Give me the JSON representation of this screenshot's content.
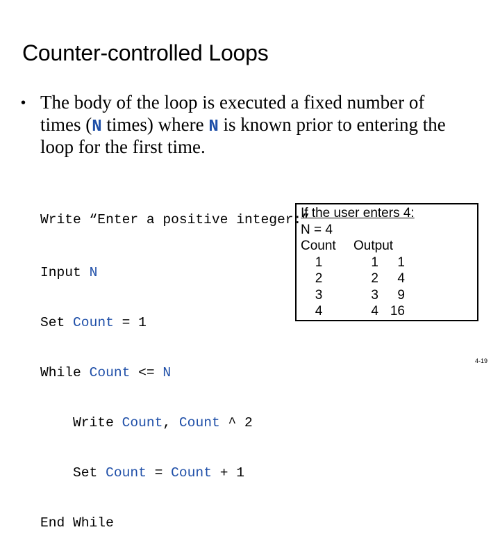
{
  "slide": {
    "title": "Counter-controlled Loops",
    "bullet": {
      "marker": "•",
      "line1": "The body of the loop is executed a fixed number of",
      "line2_prefix": "times (",
      "line2_kw1": "N",
      "line2_middle": " times) where ",
      "line2_kw2": "N",
      "line2_suffix": " is known prior to entering the",
      "line3": "loop for the first time."
    },
    "pseudocode": {
      "line1": "Write “Enter a positive integer:”",
      "line2_text": "Input ",
      "line2_var": "N",
      "line3_text": "Set ",
      "line3_var": "Count",
      "line3_rest": " = 1",
      "line4_text": "While ",
      "line4_var1": "Count",
      "line4_mid": " <= ",
      "line4_var2": "N",
      "line5_indent": "    Write ",
      "line5_var1": "Count",
      "line5_mid": ", ",
      "line5_var2": "Count",
      "line5_rest": " ^ 2",
      "line6_indent": "    Set ",
      "line6_var1": "Count",
      "line6_mid": " = ",
      "line6_var2": "Count",
      "line6_rest": " + 1",
      "line7": "End While"
    },
    "trace": {
      "heading": "If the user enters 4:",
      "n_line": "N = 4",
      "col_count": "Count",
      "col_output": "Output",
      "rows": [
        {
          "count": "1",
          "out_n": "1",
          "out_sq": "1"
        },
        {
          "count": "2",
          "out_n": "2",
          "out_sq": "4"
        },
        {
          "count": "3",
          "out_n": "3",
          "out_sq": "9"
        },
        {
          "count": "4",
          "out_n": "4",
          "out_sq": "16"
        }
      ]
    },
    "page_number": "4-19"
  }
}
